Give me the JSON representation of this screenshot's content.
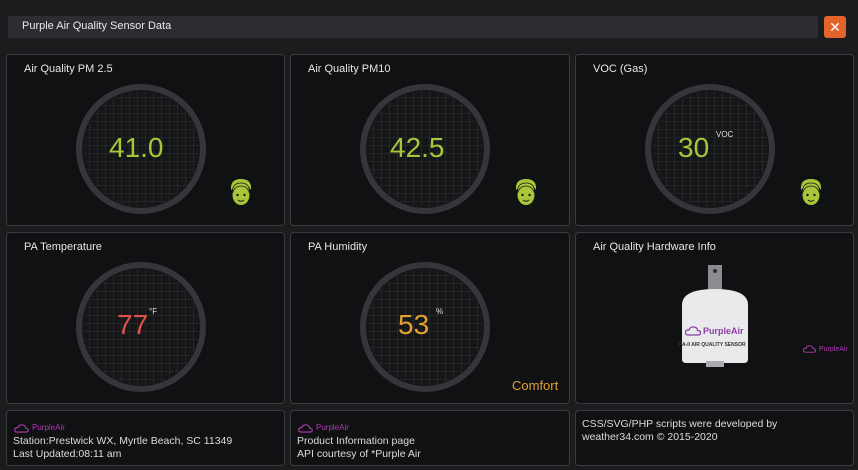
{
  "window": {
    "title": "Purple Air Quality Sensor Data",
    "close_symbol": "✕"
  },
  "panels": {
    "pm25": {
      "title": "Air Quality PM 2.5",
      "value": "41.0",
      "color": "#a8c63a"
    },
    "pm10": {
      "title": "Air Quality PM10",
      "value": "42.5",
      "color": "#a8c63a"
    },
    "voc": {
      "title": "VOC (Gas)",
      "value": "30",
      "unit": "VOC",
      "color": "#a8c63a"
    },
    "temp": {
      "title": "PA Temperature",
      "value": "77",
      "unit": "°F",
      "color": "#e0514a"
    },
    "humidity": {
      "title": "PA Humidity",
      "value": "53",
      "unit": "%",
      "color": "#e1a12f",
      "status": "Comfort"
    },
    "hardware": {
      "title": "Air Quality Hardware Info",
      "brand": "PurpleAir",
      "model": "PA-II AIR QUALITY SENSOR",
      "logo_text": "PurpleAir"
    }
  },
  "footer": {
    "station": {
      "logo": "PurpleAir",
      "line1": "Station:Prestwick WX, Myrtle Beach, SC 11349",
      "line2": "Last Updated:08:11 am"
    },
    "product": {
      "logo": "PurpleAir",
      "line1": "Product Information page",
      "line2": "API courtesy of *Purple Air"
    },
    "credits": {
      "line1": "CSS/SVG/PHP scripts were developed by",
      "line2": "weather34.com © 2015-2020"
    }
  },
  "colors": {
    "accent_purple": "#b03ab3",
    "good_green": "#a8c63a",
    "warm_red": "#e0514a",
    "comfort_orange": "#e1a12f",
    "close_orange": "#e2642a"
  }
}
